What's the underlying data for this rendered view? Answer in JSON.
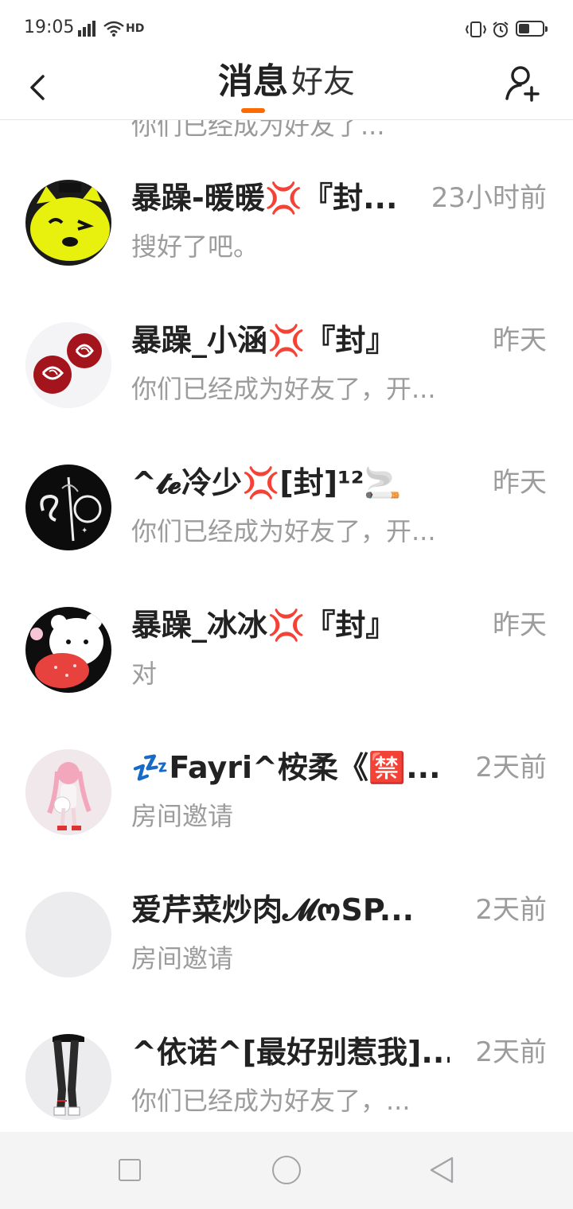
{
  "status_bar": {
    "time": "19:05",
    "network_label": "4G",
    "hd_label": "HD",
    "battery_percent": 0.45
  },
  "header": {
    "tabs": [
      {
        "label": "消息",
        "active": true
      },
      {
        "label": "好友",
        "active": false
      }
    ],
    "accent_color": "#ff6a00",
    "back_icon": "chevron-left-icon",
    "add_friend_icon": "add-user-icon"
  },
  "conversations": {
    "partial_top": {
      "preview": "你们已经成为好友了..."
    },
    "items": [
      {
        "name": "暴躁-暖暖💢『封...",
        "time": "23小时前",
        "preview": "搜好了吧。",
        "avatar": "yellow-cat-avatar"
      },
      {
        "name": "暴躁_小涵💢『封』",
        "time": "昨天",
        "preview": "你们已经成为好友了，开...",
        "avatar": "rose-avatar"
      },
      {
        "name": "^𝓽𝓮冷少💢[封]¹²🚬",
        "time": "昨天",
        "preview": "你们已经成为好友了，开...",
        "avatar": "dark-graffiti-avatar"
      },
      {
        "name": "暴躁_冰冰💢『封』",
        "time": "昨天",
        "preview": "对",
        "avatar": "bear-strawberry-avatar"
      },
      {
        "name": "💤Fayri^桉柔《🈲...",
        "time": "2天前",
        "preview": "房间邀请",
        "avatar": "anime-girl-avatar"
      },
      {
        "name": "爱芹菜炒肉𝓜ოSP...",
        "time": "2天前",
        "preview": "房间邀请",
        "avatar": "blank-avatar"
      },
      {
        "name": "^依诺^[最好别惹我]...",
        "time": "2天前",
        "preview": "你们已经成为好友了，...",
        "avatar": "legs-avatar"
      }
    ]
  },
  "nav_bar": {
    "icons": [
      "recent-apps-icon",
      "home-icon",
      "back-triangle-icon"
    ]
  }
}
